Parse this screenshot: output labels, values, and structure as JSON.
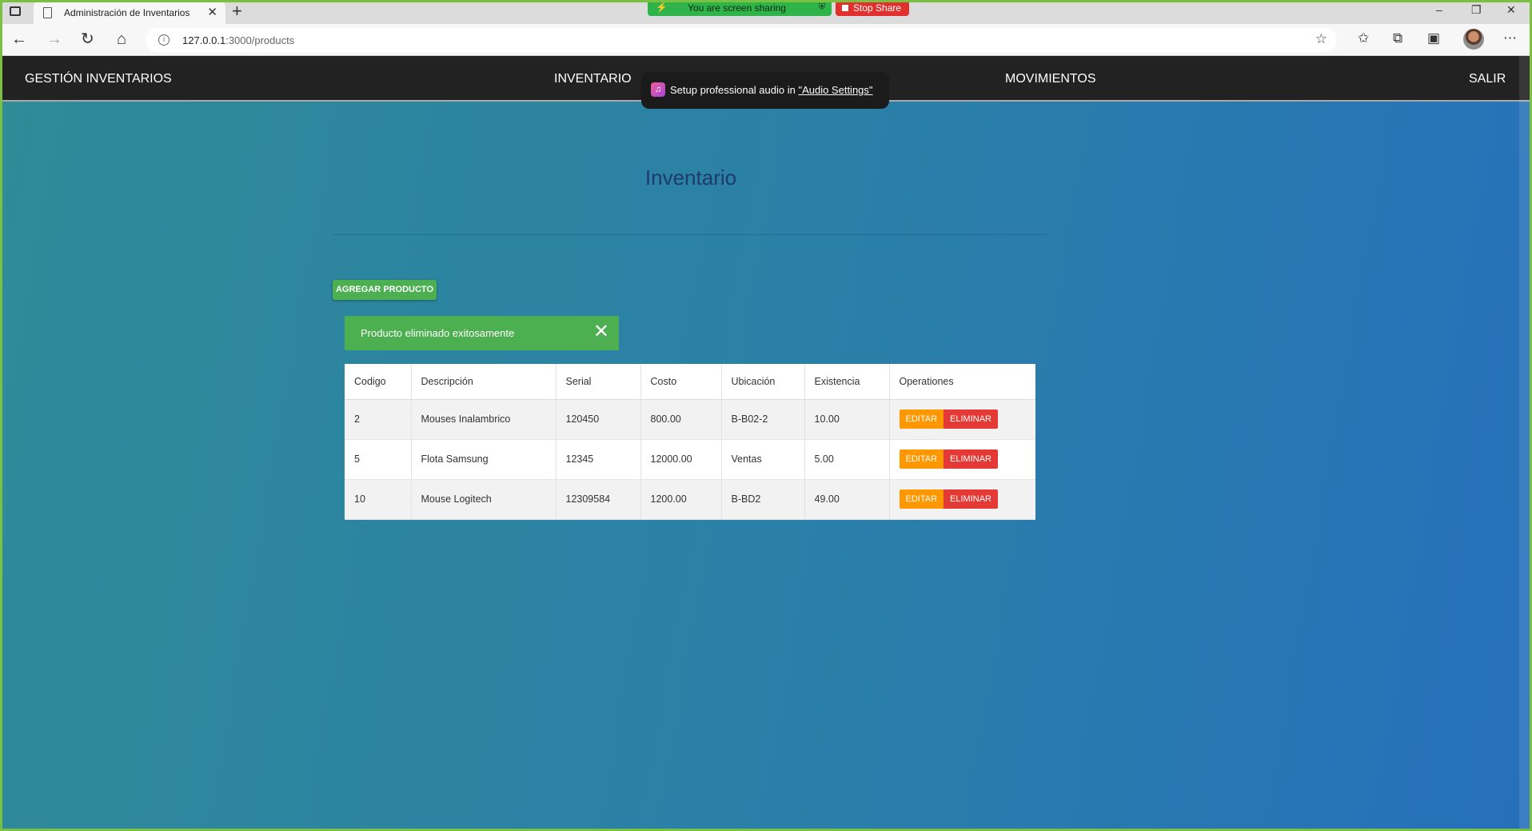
{
  "browser": {
    "tab_title": "Administración de Inventarios",
    "new_tab_symbol": "+",
    "url_host": "127.0.0.1",
    "url_rest": ":3000/products",
    "window_controls": [
      "–",
      "❐",
      "✕"
    ]
  },
  "screen_share": {
    "status_text": "You are screen sharing",
    "stop_label": "Stop Share",
    "accent": "#2fb44a",
    "stop_color": "#e0312e"
  },
  "navbar": {
    "brand": "GESTIÓN INVENTARIOS",
    "inventory": "INVENTARIO",
    "movements": "MOVIMIENTOS",
    "logout": "SALIR"
  },
  "toast": {
    "text": "Setup professional audio in ",
    "link": "\"Audio Settings\""
  },
  "page": {
    "title": "Inventario",
    "add_button": "AGREGAR PRODUCTO",
    "alert_message": "Producto eliminado exitosamente",
    "alert_close": "✕"
  },
  "table": {
    "headers": [
      "Codigo",
      "Descripción",
      "Serial",
      "Costo",
      "Ubicación",
      "Existencia",
      "Operationes"
    ],
    "rows": [
      {
        "codigo": "2",
        "descripcion": "Mouses Inalambrico",
        "serial": "120450",
        "costo": "800.00",
        "ubicacion": "B-B02-2",
        "existencia": "10.00"
      },
      {
        "codigo": "5",
        "descripcion": "Flota Samsung",
        "serial": "12345",
        "costo": "12000.00",
        "ubicacion": "Ventas",
        "existencia": "5.00"
      },
      {
        "codigo": "10",
        "descripcion": "Mouse Logitech",
        "serial": "12309584",
        "costo": "1200.00",
        "ubicacion": "B-BD2",
        "existencia": "49.00"
      }
    ],
    "edit_label": "EDITAR",
    "delete_label": "ELIMINAR"
  },
  "colors": {
    "navbar_bg": "#222222",
    "success_green": "#4caf50",
    "edit_orange": "#ff9800",
    "delete_red": "#e53935",
    "title_blue": "#1d3a6b"
  }
}
